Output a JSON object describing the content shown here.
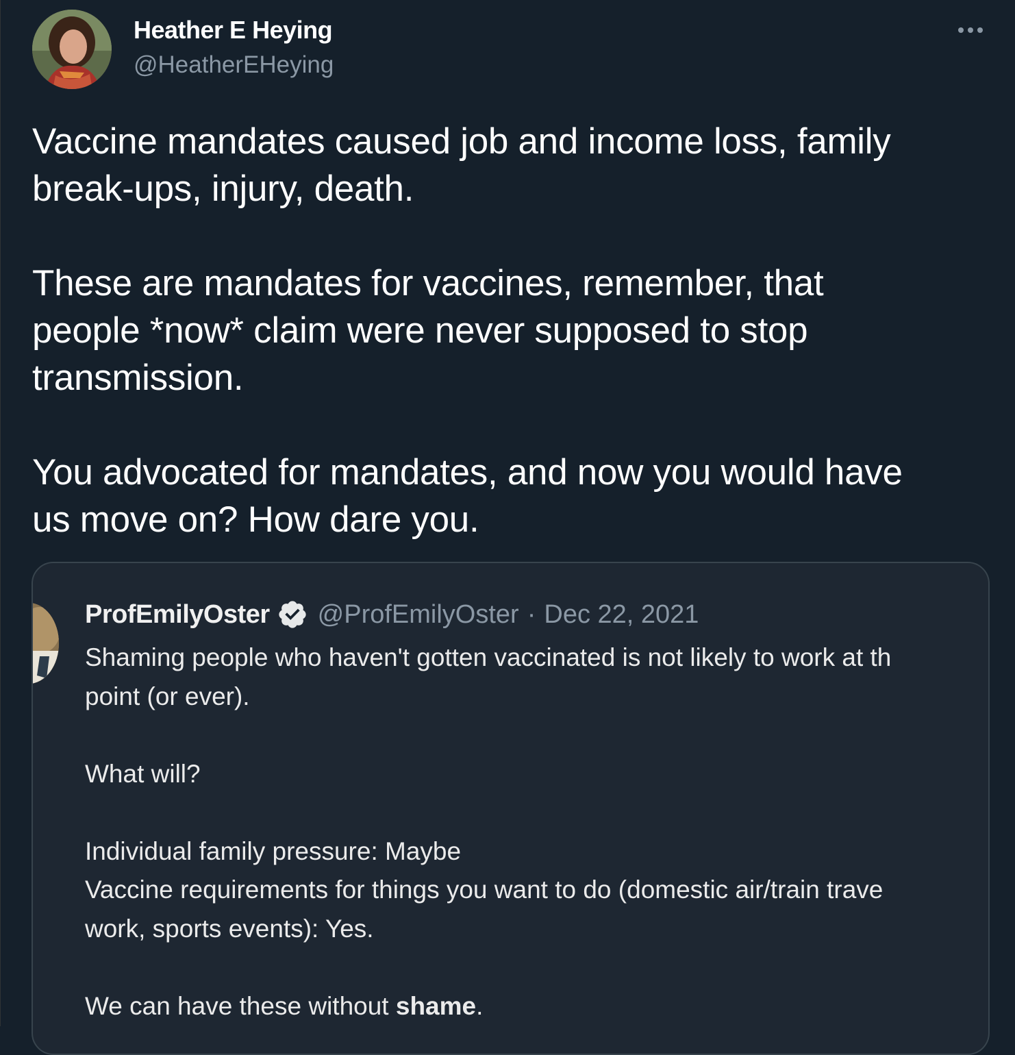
{
  "tweet": {
    "author": {
      "display_name": "Heather E Heying",
      "handle": "@HeatherEHeying",
      "avatar_icon": "profile-photo"
    },
    "more_icon": "more-horizontal-icon",
    "paragraphs": [
      "Vaccine mandates caused job and income loss, family\nbreak-ups, injury, death.",
      "These are mandates for vaccines, remember, that\npeople *now* claim were never supposed to stop\ntransmission.",
      "You advocated for mandates, and now you would have\nus move on? How dare you."
    ]
  },
  "quoted_tweet": {
    "display_name": "ProfEmilyOster",
    "verified_icon": "verified-badge-icon",
    "handle": "@ProfEmilyOster",
    "separator": "·",
    "date": "Dec 22, 2021",
    "lines": {
      "l1": "Shaming people who haven't gotten vaccinated is not likely to work at th",
      "l2": "point (or ever).",
      "l3": "What will?",
      "l4": "Individual family pressure: Maybe",
      "l5": "Vaccine requirements for things you want to do (domestic air/train trave",
      "l6": "work, sports events): Yes.",
      "l7_prefix": "We can have these without ",
      "l7_bold": "shame",
      "l7_suffix": "."
    }
  },
  "colors": {
    "background": "#15202b",
    "quote_background": "#1e2732",
    "border": "#38444d",
    "secondary_text": "#8b98a5",
    "primary_text": "#ffffff"
  }
}
